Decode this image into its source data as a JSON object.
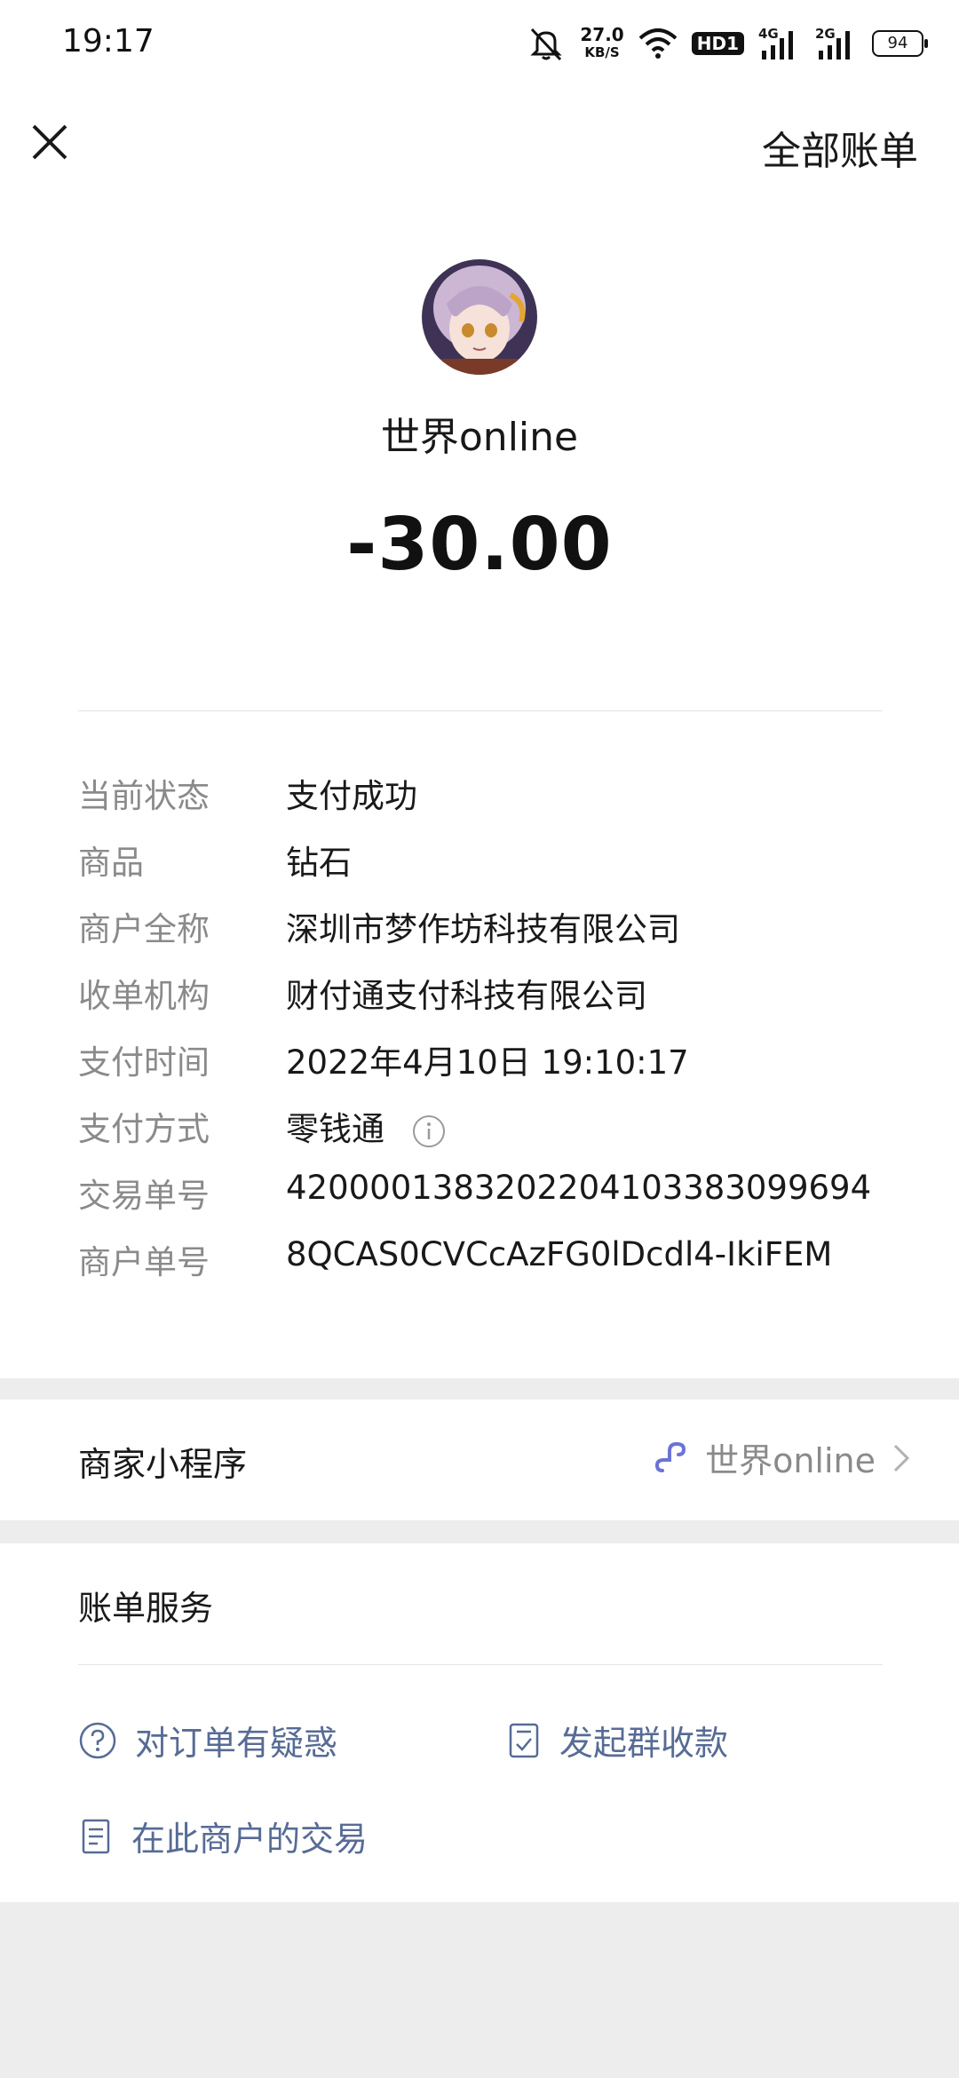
{
  "status_bar": {
    "time": "19:17",
    "speed_value": "27.0",
    "speed_unit": "KB/S",
    "hd_label": "HD1",
    "net1": "4G",
    "net2": "2G",
    "battery": "94",
    "icons": [
      "mute-bell-icon",
      "wifi-icon",
      "signal-icon",
      "battery-icon"
    ]
  },
  "nav": {
    "close_icon": "close-icon",
    "all_bills": "全部账单"
  },
  "merchant": {
    "name": "世界online",
    "amount": "-30.00"
  },
  "details": [
    {
      "key": "当前状态",
      "value": "支付成功"
    },
    {
      "key": "商品",
      "value": "钻石"
    },
    {
      "key": "商户全称",
      "value": "深圳市梦作坊科技有限公司"
    },
    {
      "key": "收单机构",
      "value": "财付通支付科技有限公司"
    },
    {
      "key": "支付时间",
      "value": "2022年4月10日 19:10:17"
    },
    {
      "key": "支付方式",
      "value": "零钱通"
    },
    {
      "key": "交易单号",
      "value": "4200001383202204103383099694"
    },
    {
      "key": "商户单号",
      "value": "8QCAS0CVCcAzFG0lDcdl4-IkiFEM"
    }
  ],
  "mini_program": {
    "label": "商家小程序",
    "name": "世界online"
  },
  "bill_service": {
    "title": "账单服务",
    "items": [
      {
        "label": "对订单有疑惑",
        "icon": "question-circle-icon"
      },
      {
        "label": "发起群收款",
        "icon": "group-collect-icon"
      },
      {
        "label": "在此商户的交易",
        "icon": "document-icon"
      }
    ]
  },
  "colors": {
    "link": "#576b95",
    "mini_program_icon": "#6b73d6",
    "background": "#ededed"
  }
}
